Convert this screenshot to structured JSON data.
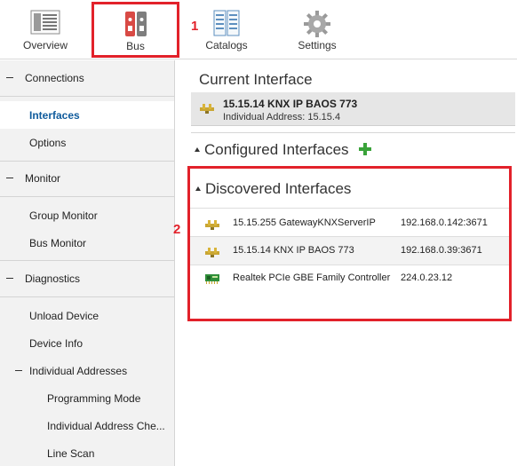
{
  "toolbar": {
    "overview_label": "Overview",
    "bus_label": "Bus",
    "catalogs_label": "Catalogs",
    "settings_label": "Settings"
  },
  "annotations": {
    "one": "1",
    "two": "2"
  },
  "sidebar": {
    "connections": "Connections",
    "interfaces": "Interfaces",
    "options": "Options",
    "monitor": "Monitor",
    "group_monitor": "Group Monitor",
    "bus_monitor": "Bus Monitor",
    "diagnostics": "Diagnostics",
    "unload_device": "Unload Device",
    "device_info": "Device Info",
    "individual_addresses": "Individual Addresses",
    "programming_mode": "Programming Mode",
    "individual_address_check": "Individual Address Che...",
    "line_scan": "Line Scan"
  },
  "main": {
    "current_heading": "Current Interface",
    "current_name": "15.15.14 KNX IP BAOS 773",
    "current_address": "Individual Address: 15.15.4",
    "configured_heading": "Configured Interfaces",
    "discovered_heading": "Discovered Interfaces",
    "discovered": [
      {
        "name": "15.15.255 GatewayKNXServerIP",
        "address": "192.168.0.142:3671",
        "icon": "knx-plug-icon"
      },
      {
        "name": "15.15.14 KNX IP BAOS 773",
        "address": "192.168.0.39:3671",
        "icon": "knx-plug-icon"
      },
      {
        "name": "Realtek PCIe GBE Family Controller",
        "address": "224.0.23.12",
        "icon": "network-card-icon"
      }
    ]
  },
  "colors": {
    "accent_red": "#e2212a",
    "selected_blue": "#0f5b9c",
    "add_green": "#3aa33a"
  }
}
